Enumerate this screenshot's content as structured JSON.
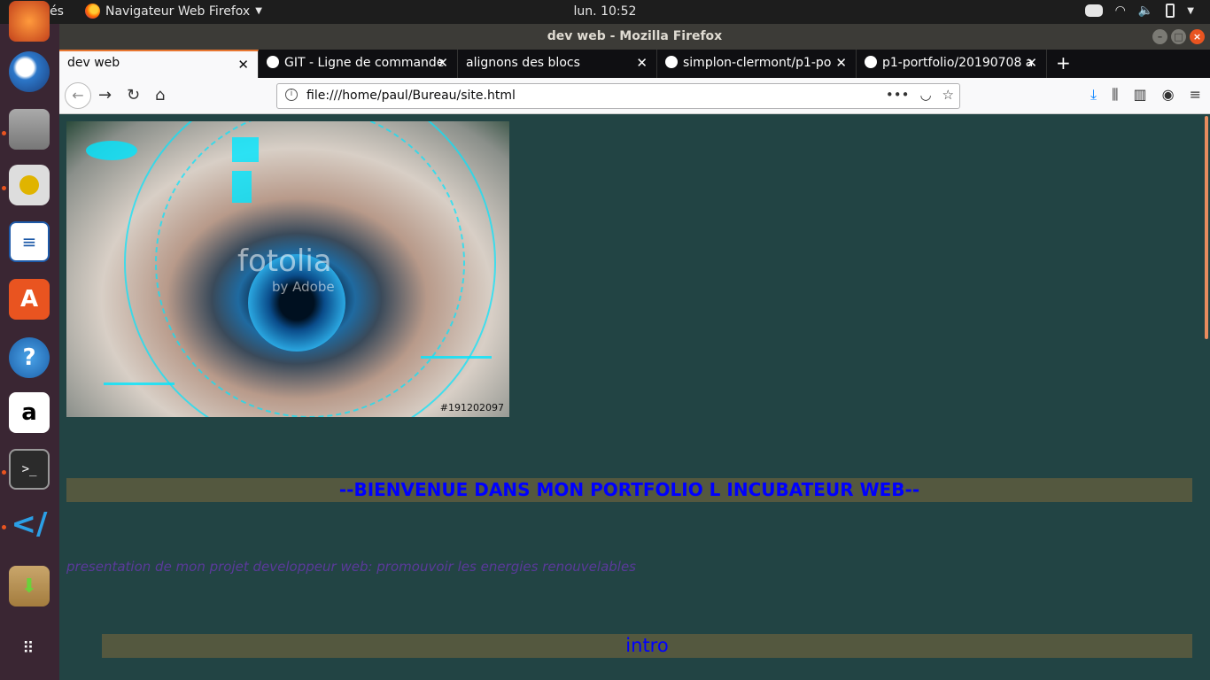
{
  "topbar": {
    "activities": "Activités",
    "app_menu": "Navigateur Web Firefox",
    "clock": "lun. 10:52"
  },
  "window": {
    "title": "dev web - Mozilla Firefox"
  },
  "tabs": [
    {
      "label": "dev web",
      "active": true
    },
    {
      "label": "GIT - Ligne de commande",
      "active": false
    },
    {
      "label": "alignons des blocs",
      "active": false
    },
    {
      "label": "simplon-clermont/p1-po",
      "active": false
    },
    {
      "label": "p1-portfolio/20190708 a",
      "active": false
    }
  ],
  "urlbar": {
    "url": "file:///home/paul/Bureau/site.html"
  },
  "page": {
    "image_id": "#191202097",
    "watermark": "fotolia",
    "watermark_sub": "by Adobe",
    "welcome": "--BIENVENUE DANS MON PORTFOLIO L INCUBATEUR WEB--",
    "presentation": "presentation de mon projet developpeur web: promouvoir les energies renouvelables",
    "intro": "intro"
  },
  "colors": {
    "page_background": "#224444",
    "heading_band": "#54583f",
    "heading_text": "#0000ff",
    "presentation_text": "#5a3a9a",
    "accent": "#e95420"
  },
  "dock": [
    "firefox-icon",
    "files-icon",
    "rhythmbox-icon",
    "libreoffice-writer-icon",
    "software-center-icon",
    "help-icon",
    "amazon-icon",
    "terminal-icon",
    "vscode-icon",
    "archive-manager-icon",
    "show-applications-icon"
  ]
}
